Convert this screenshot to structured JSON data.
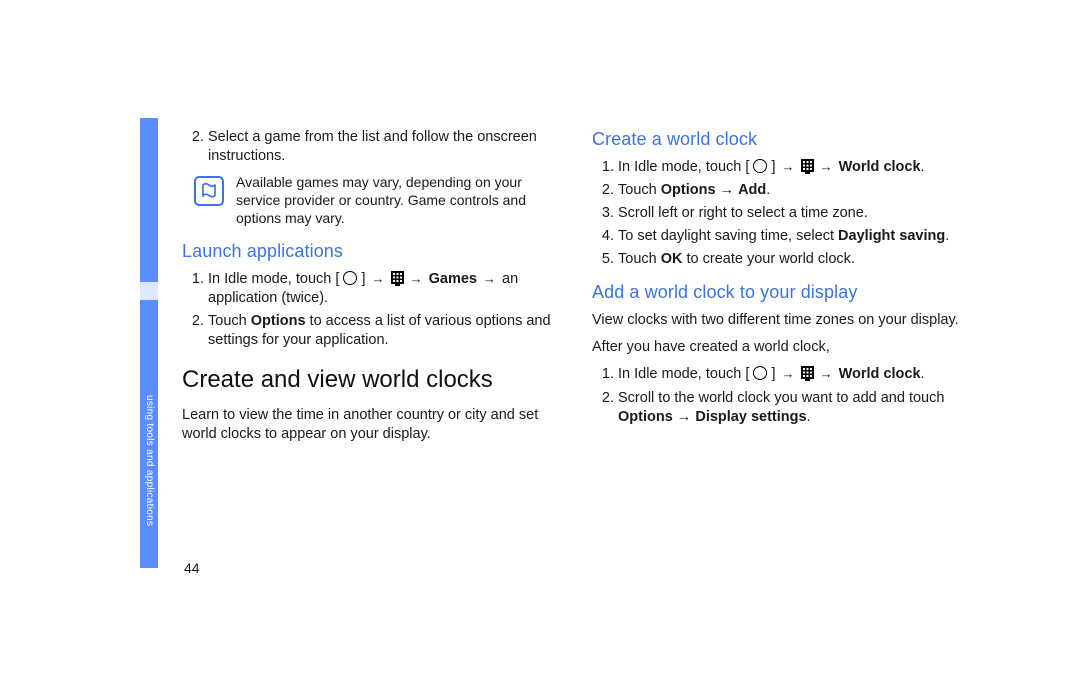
{
  "pageNumber": "44",
  "sideLabel": "using tools and applications",
  "colL": {
    "topList": [
      {
        "num": "2.",
        "text": "Select a game from the list and follow the onscreen instructions."
      }
    ],
    "noteText": "Available games may vary, depending on your service provider or country. Game controls and options may vary.",
    "h2_launch": "Launch applications",
    "launchList": {
      "item1": {
        "num": "1.",
        "pre": "In Idle mode, touch [",
        "mid": "] ",
        "arr": "→",
        "bold_games": "Games",
        "post": " an application (twice)."
      },
      "item2": {
        "num": "2.",
        "pre": "Touch ",
        "bold_options": "Options",
        "post": " to access a list of various options and settings for your application."
      }
    },
    "h1_world": "Create and view world clocks",
    "worldIntro": "Learn to view the time in another country or city and set world clocks to appear on your display."
  },
  "colR": {
    "h2_create": "Create a world clock",
    "createList": {
      "item1": {
        "num": "1.",
        "pre": "In Idle mode, touch [",
        "mid": "] ",
        "arr": "→",
        "bold_wc": "World clock",
        "period": "."
      },
      "item2": {
        "num": "2.",
        "pre": "Touch ",
        "b_opt": "Options",
        "arr": " → ",
        "b_add": "Add",
        "period": "."
      },
      "item3": {
        "num": "3.",
        "text": "Scroll left or right to select a time zone."
      },
      "item4": {
        "num": "4.",
        "pre": "To set daylight saving time, select ",
        "b_day": "Daylight saving",
        "period": "."
      },
      "item5": {
        "num": "5.",
        "pre": "Touch ",
        "b_ok": "OK",
        "post": " to create your world clock."
      }
    },
    "h2_add": "Add a world clock to your display",
    "addIntro": "View clocks with two different time zones on your display.",
    "addAfter": "After you have created a world clock,",
    "addList": {
      "item1": {
        "num": "1.",
        "pre": "In Idle mode, touch [",
        "mid": "] ",
        "arr": "→",
        "bold_wc": "World clock",
        "period": "."
      },
      "item2": {
        "num": "2.",
        "pre": "Scroll to the world clock you want to add and touch ",
        "b_opt": "Options",
        "arr": " → ",
        "b_disp": "Display settings",
        "period": "."
      }
    }
  }
}
